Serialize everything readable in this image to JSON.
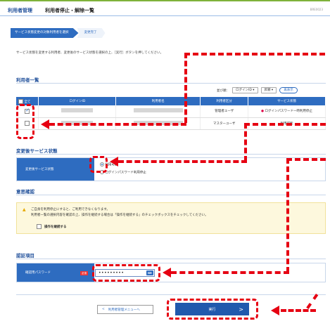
{
  "header": {
    "section": "利用者管理",
    "page_title": "利用者停止・解除一覧",
    "screen_id": "BRE0023"
  },
  "steps": [
    "サービス状態変更の対象利用者を選択",
    "変更完了"
  ],
  "intro": "サービス状態を変更する利用者、変更後のサービス状態を選択の上、［実行］ボタンを押してください。",
  "user_list": {
    "title": "利用者一覧",
    "sort_label": "並び順：",
    "sort_field": "ログインID",
    "sort_order": "昇順",
    "resort_button": "再表示",
    "columns": [
      "全て",
      "ログインID",
      "利用者名",
      "利用者区分",
      "サービス状態"
    ],
    "rows": [
      {
        "checked": true,
        "type": "管理者ユーザ",
        "status": "ログインパスワード一時利用停止",
        "warn": true
      },
      {
        "checked": false,
        "type": "マスターユーザ",
        "status": "利用可能",
        "warn": false
      }
    ]
  },
  "service": {
    "title": "変更後サービス状態",
    "label": "変更後サービス状態",
    "options": [
      "利用可能",
      "ログインパスワード利用停止"
    ]
  },
  "confirm": {
    "title": "意思確認",
    "line1": "ご自身を利用停止にすると、ご利用できなくなります。",
    "line2": "利用者一覧の選択内容を確認の上、操作を継続する場合は「操作を継続する」のチェックボックスをチェックしてください。",
    "checkbox_label": "操作を継続する"
  },
  "auth": {
    "title": "認証項目",
    "label": "確認用パスワード",
    "required": "必須",
    "password_value": "•••••••••"
  },
  "buttons": {
    "back": "利用者管理メニューへ",
    "back_arrow": "<",
    "execute": "実行",
    "execute_arrow": ">"
  },
  "colors": {
    "accent": "#2e6cc0",
    "highlight": "#e60012",
    "notice_bg": "#fdf8dd"
  }
}
